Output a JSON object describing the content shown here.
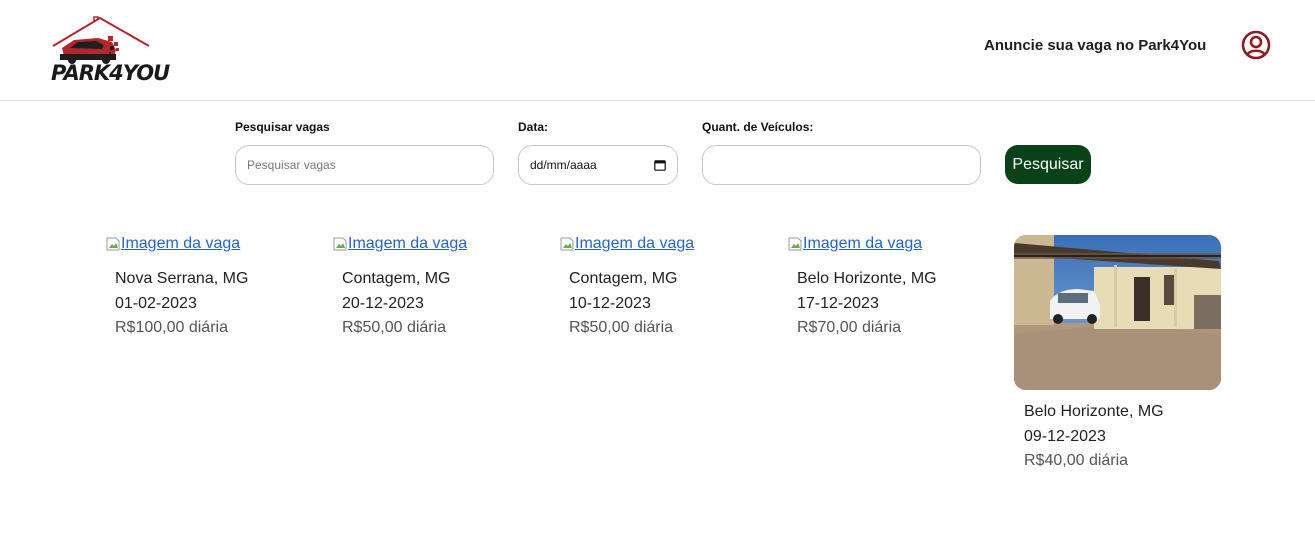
{
  "header": {
    "logo_text": "PARK4YOU",
    "announce_link": "Anuncie sua vaga no Park4You",
    "user_icon": "user-circle-icon"
  },
  "search": {
    "query_label": "Pesquisar vagas",
    "query_placeholder": "Pesquisar vagas",
    "date_label": "Data:",
    "date_placeholder": "dd/mm/aaaa",
    "vehicles_label": "Quant. de Veículos:",
    "vehicles_value": "",
    "button_label": "Pesquisar"
  },
  "listings": [
    {
      "image_alt": "Imagem da vaga",
      "location": "Nova Serrana, MG",
      "date": "01-02-2023",
      "price": "R$100,00 diária"
    },
    {
      "image_alt": "Imagem da vaga",
      "location": "Contagem, MG",
      "date": "20-12-2023",
      "price": "R$50,00 diária"
    },
    {
      "image_alt": "Imagem da vaga",
      "location": "Contagem, MG",
      "date": "10-12-2023",
      "price": "R$50,00 diária"
    },
    {
      "image_alt": "Imagem da vaga",
      "location": "Belo Horizonte, MG",
      "date": "17-12-2023",
      "price": "R$70,00 diária"
    },
    {
      "image_alt": "Imagem da vaga",
      "location": "Belo Horizonte, MG",
      "date": "09-12-2023",
      "price": "R$40,00 diária"
    }
  ],
  "colors": {
    "primary_button": "#094219",
    "logo_red": "#b3262b",
    "user_icon": "#8c1d24",
    "link": "#2764c8"
  }
}
